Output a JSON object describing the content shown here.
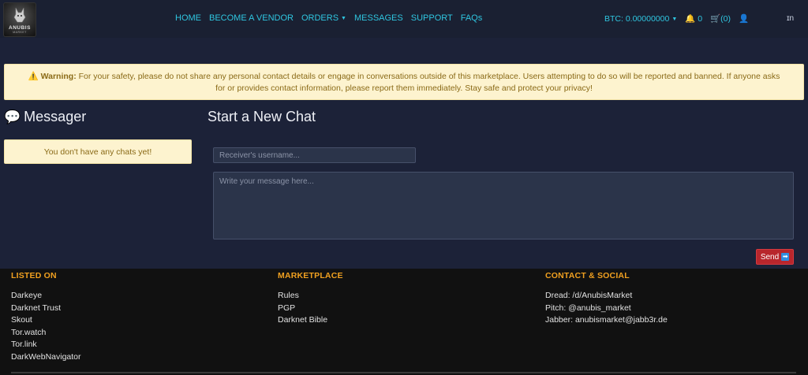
{
  "logo": {
    "text": "ANUBIS",
    "sub": "MARKET"
  },
  "nav": {
    "links": [
      {
        "label": "HOME"
      },
      {
        "label": "BECOME A VENDOR"
      },
      {
        "label": "ORDERS"
      },
      {
        "label": "MESSAGES"
      },
      {
        "label": "SUPPORT"
      },
      {
        "label": "FAQs"
      }
    ],
    "btc": "BTC: 0.00000000",
    "notifications": "0",
    "cart": "(0)",
    "lang": "ɪn"
  },
  "warning": {
    "label": "Warning:",
    "text": " For your safety, please do not share any personal contact details or engage in conversations outside of this marketplace. Users attempting to do so will be reported and banned. If anyone asks for or provides contact information, please report them immediately. Stay safe and protect your privacy!"
  },
  "messager": {
    "title": "Messager",
    "empty": "You don't have any chats yet!"
  },
  "new_chat": {
    "title": "Start a New Chat",
    "receiver_placeholder": "Receiver's username...",
    "message_placeholder": "Write your message here...",
    "send_label": "Send"
  },
  "footer": {
    "listed_on": {
      "title": "LISTED ON",
      "items": [
        "Darkeye",
        "Darknet Trust",
        "Skout",
        "Tor.watch",
        "Tor.link",
        "DarkWebNavigator"
      ]
    },
    "marketplace": {
      "title": "MARKETPLACE",
      "items": [
        "Rules",
        "PGP",
        "Darknet Bible"
      ]
    },
    "contact": {
      "title": "CONTACT & SOCIAL",
      "items": [
        "Dread: /d/AnubisMarket",
        "Pitch: @anubis_market",
        "Jabber: anubismarket@jabb3r.de"
      ]
    }
  },
  "colors": {
    "accent": "#2fc6e0",
    "warning_bg": "#fdf3cf",
    "send": "#b8262c",
    "footer_heading": "#f0a020"
  }
}
